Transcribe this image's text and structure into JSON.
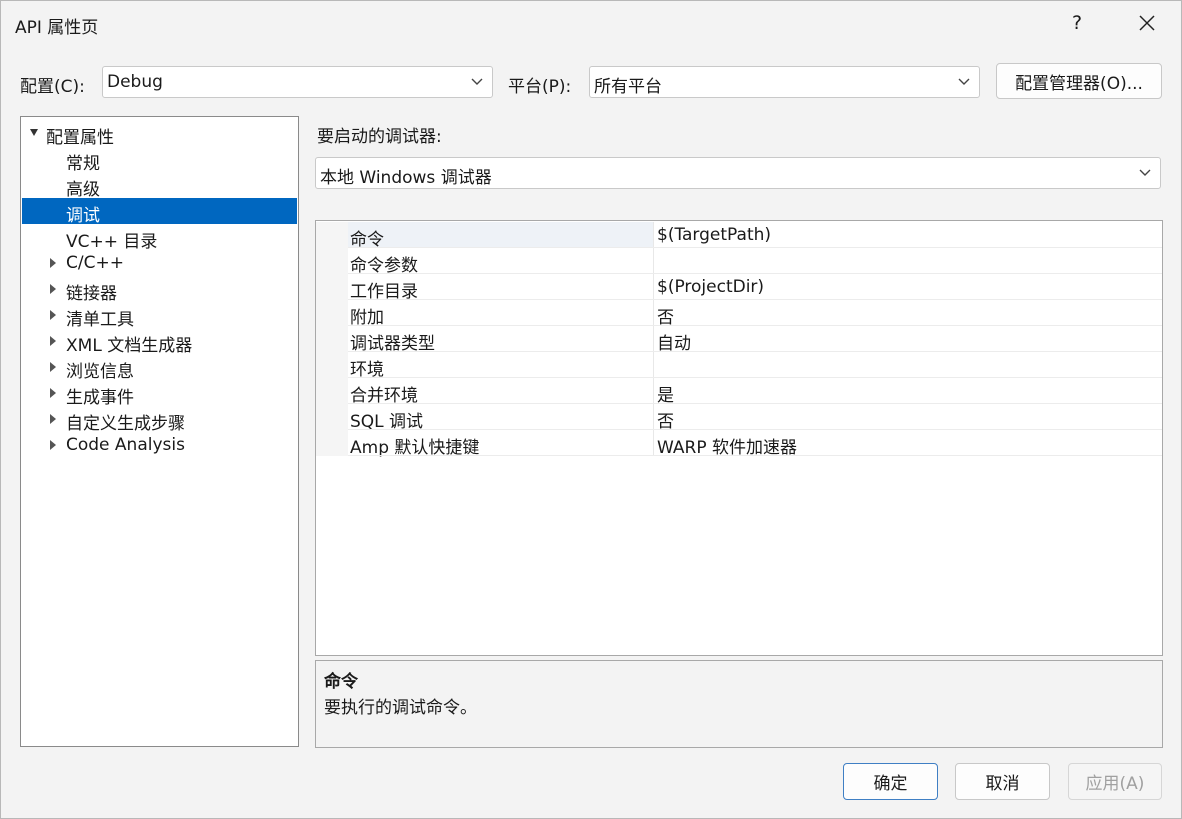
{
  "window": {
    "title": "API 属性页",
    "help_label": "?",
    "close_icon": "close-icon"
  },
  "config": {
    "label": "配置(C):",
    "value": "Debug"
  },
  "platform": {
    "label": "平台(P):",
    "value": "所有平台"
  },
  "config_manager_label": "配置管理器(O)...",
  "tree": {
    "root": "配置属性",
    "items": [
      {
        "label": "常规",
        "expandable": false,
        "selected": false
      },
      {
        "label": "高级",
        "expandable": false,
        "selected": false
      },
      {
        "label": "调试",
        "expandable": false,
        "selected": true
      },
      {
        "label": "VC++ 目录",
        "expandable": false,
        "selected": false
      },
      {
        "label": "C/C++",
        "expandable": true,
        "selected": false
      },
      {
        "label": "链接器",
        "expandable": true,
        "selected": false
      },
      {
        "label": "清单工具",
        "expandable": true,
        "selected": false
      },
      {
        "label": "XML 文档生成器",
        "expandable": true,
        "selected": false
      },
      {
        "label": "浏览信息",
        "expandable": true,
        "selected": false
      },
      {
        "label": "生成事件",
        "expandable": true,
        "selected": false
      },
      {
        "label": "自定义生成步骤",
        "expandable": true,
        "selected": false
      },
      {
        "label": "Code Analysis",
        "expandable": true,
        "selected": false
      }
    ]
  },
  "debugger": {
    "label": "要启动的调试器:",
    "value": "本地 Windows 调试器"
  },
  "properties": [
    {
      "name": "命令",
      "value": "$(TargetPath)"
    },
    {
      "name": "命令参数",
      "value": ""
    },
    {
      "name": "工作目录",
      "value": "$(ProjectDir)"
    },
    {
      "name": "附加",
      "value": "否"
    },
    {
      "name": "调试器类型",
      "value": "自动"
    },
    {
      "name": "环境",
      "value": ""
    },
    {
      "name": "合并环境",
      "value": "是"
    },
    {
      "name": "SQL 调试",
      "value": "否"
    },
    {
      "name": "Amp 默认快捷键",
      "value": "WARP 软件加速器"
    }
  ],
  "description": {
    "title": "命令",
    "text": "要执行的调试命令。"
  },
  "buttons": {
    "ok": "确定",
    "cancel": "取消",
    "apply": "应用(A)"
  },
  "colors": {
    "selection": "#0067c0",
    "primary_border": "#3f7fc4"
  }
}
